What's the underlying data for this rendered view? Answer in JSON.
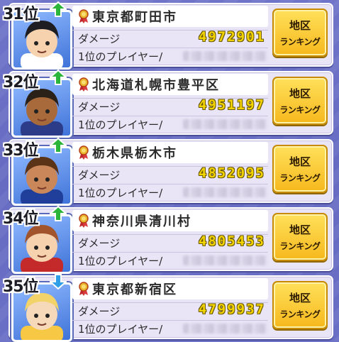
{
  "rows": [
    {
      "rank": "31位",
      "trend": "up",
      "area": "東京都町田市",
      "label": "ダメージ",
      "score": "4972901",
      "player_label": "1位のプレイヤー/",
      "button_line1": "地区",
      "button_line2": "ランキング",
      "hair": "#1d1d22",
      "skin": "#f6d2ae",
      "shirt": "#ffffff"
    },
    {
      "rank": "32位",
      "trend": "up",
      "area": "北海道札幌市豊平区",
      "label": "ダメージ",
      "score": "4951197",
      "player_label": "1位のプレイヤー/",
      "button_line1": "地区",
      "button_line2": "ランキング",
      "hair": "#2a2118",
      "skin": "#a8693b",
      "shirt": "#2c3c88"
    },
    {
      "rank": "33位",
      "trend": "up",
      "area": "栃木県栃木市",
      "label": "ダメージ",
      "score": "4852095",
      "player_label": "1位のプレイヤー/",
      "button_line1": "地区",
      "button_line2": "ランキング",
      "hair": "#5b3417",
      "skin": "#c9875a",
      "shirt": "#1f3f9a"
    },
    {
      "rank": "34位",
      "trend": "up",
      "area": "神奈川県清川村",
      "label": "ダメージ",
      "score": "4805453",
      "player_label": "1位のプレイヤー/",
      "button_line1": "地区",
      "button_line2": "ランキング",
      "hair": "#a2552c",
      "skin": "#f6d2ae",
      "shirt": "#c42a2a"
    },
    {
      "rank": "35位",
      "trend": "down",
      "area": "東京都新宿区",
      "label": "ダメージ",
      "score": "4799937",
      "player_label": "1位のプレイヤー/",
      "button_line1": "地区",
      "button_line2": "ランキング",
      "hair": "#f1d36a",
      "skin": "#f6d9b8",
      "shirt": "#f6c843"
    }
  ],
  "colors": {
    "trend_up": "#2bb53b",
    "trend_down": "#2fa0e8",
    "score": "#f4d400",
    "button": "#f6b81d"
  },
  "icons": {
    "medal": "medal-icon",
    "trend_up": "arrow-up-icon",
    "trend_down": "arrow-down-icon"
  }
}
